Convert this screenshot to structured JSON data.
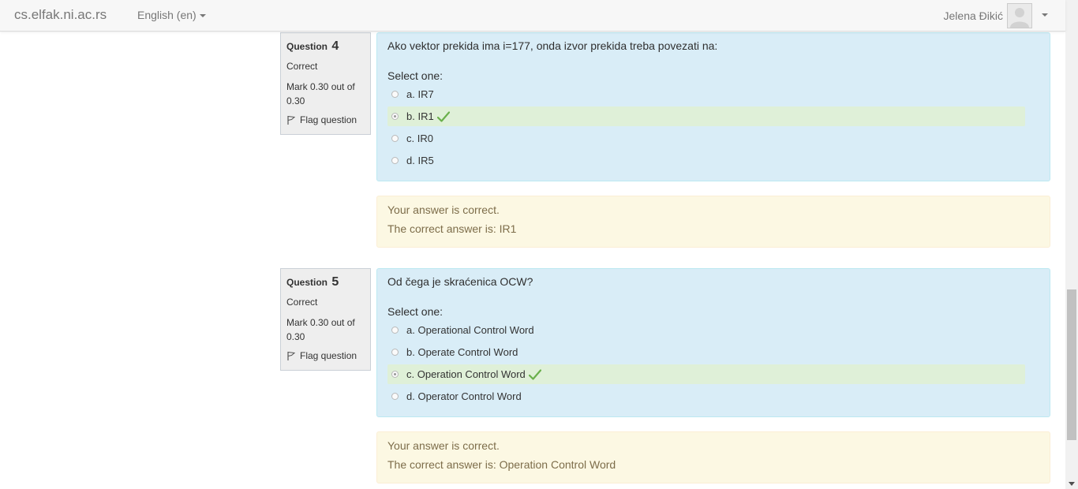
{
  "navbar": {
    "brand": "cs.elfak.ni.ac.rs",
    "language": "English (en)",
    "username": "Jelena Đikić"
  },
  "questions": [
    {
      "label": "Question",
      "number": "4",
      "state": "Correct",
      "mark": "Mark 0.30 out of 0.30",
      "flag": "Flag question",
      "text": "Ako vektor prekida ima i=177, onda izvor prekida treba povezati na:",
      "prompt": "Select one:",
      "options": [
        {
          "label": "a. IR7"
        },
        {
          "label": "b. IR1"
        },
        {
          "label": "c. IR0"
        },
        {
          "label": "d. IR5"
        }
      ],
      "feedback": "Your answer is correct.",
      "right_answer": "The correct answer is: IR1"
    },
    {
      "label": "Question",
      "number": "5",
      "state": "Correct",
      "mark": "Mark 0.30 out of 0.30",
      "flag": "Flag question",
      "text": "Od čega je skraćenica OCW?",
      "prompt": "Select one:",
      "options": [
        {
          "label": "a. Operational Control Word"
        },
        {
          "label": "b. Operate Control Word"
        },
        {
          "label": "c. Operation Control Word"
        },
        {
          "label": "d. Operator Control Word"
        }
      ],
      "feedback": "Your answer is correct.",
      "right_answer": "The correct answer is: Operation Control Word"
    }
  ],
  "colors": {
    "formulation_bg": "#d9edf7",
    "correct_option_bg": "#dff0d8",
    "outcome_bg": "#fcf8e3",
    "tick": "#6ab04c"
  }
}
